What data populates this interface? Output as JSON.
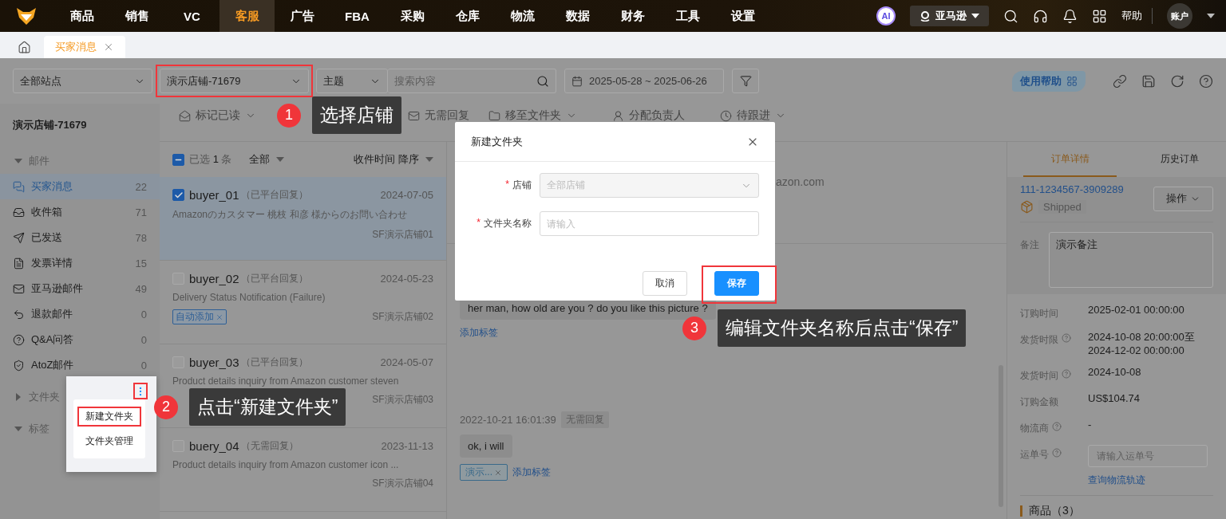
{
  "top_nav": {
    "items": [
      {
        "label": "商品",
        "selected": false
      },
      {
        "label": "销售",
        "selected": false
      },
      {
        "label": "VC",
        "selected": false
      },
      {
        "label": "客服",
        "selected": true
      },
      {
        "label": "广告",
        "selected": false
      },
      {
        "label": "FBA",
        "selected": false
      },
      {
        "label": "采购",
        "selected": false
      },
      {
        "label": "仓库",
        "selected": false
      },
      {
        "label": "物流",
        "selected": false
      },
      {
        "label": "数据",
        "selected": false
      },
      {
        "label": "财务",
        "selected": false
      },
      {
        "label": "工具",
        "selected": false
      },
      {
        "label": "设置",
        "selected": false
      }
    ],
    "ai_badge": "AI",
    "platform": "亚马逊",
    "help": "帮助",
    "account": "账户"
  },
  "page_tabs": [
    {
      "label": "买家消息",
      "selected": true
    }
  ],
  "filters": {
    "site": "全部站点",
    "store": "演示店铺-71679",
    "store_highlighted": true,
    "search_field": "主题",
    "search_placeholder": "搜索内容",
    "date_range": "2025-05-28 ~ 2025-06-26",
    "help_button": "使用帮助"
  },
  "sidebar": {
    "title": "演示店铺-71679",
    "sections": [
      {
        "label": "邮件",
        "expanded": true,
        "items": [
          {
            "label": "买家消息",
            "count": "22",
            "selected": true
          },
          {
            "label": "收件箱",
            "count": "71",
            "selected": false
          },
          {
            "label": "已发送",
            "count": "78",
            "selected": false
          },
          {
            "label": "发票详情",
            "count": "15",
            "selected": false
          },
          {
            "label": "亚马逊邮件",
            "count": "49",
            "selected": false
          },
          {
            "label": "退款邮件",
            "count": "0",
            "selected": false
          },
          {
            "label": "Q&A问答",
            "count": "0",
            "selected": false
          },
          {
            "label": "AtoZ邮件",
            "count": "0",
            "selected": false
          }
        ]
      },
      {
        "label": "文件夹",
        "expanded": false
      },
      {
        "label": "标签",
        "expanded": true
      }
    ]
  },
  "toolbar": [
    {
      "label": "标记已读",
      "dropdown": true
    },
    {
      "label": "无需回复",
      "dropdown": false
    },
    {
      "label": "移至文件夹",
      "dropdown": true
    },
    {
      "label": "分配负责人",
      "dropdown": false
    },
    {
      "label": "待跟进",
      "dropdown": true
    }
  ],
  "message_list": {
    "indeterminate": true,
    "selected_label": "已选",
    "selected_count": "1",
    "selected_unit": "条",
    "filter": "全部",
    "sort": "收件时间 降序",
    "items": [
      {
        "buyer": "buyer_01",
        "status": "（已平台回复）",
        "date": "2024-07-05",
        "subject": "Amazonのカスタマー 桃枝 和彦 様からのお問い合わせ",
        "store": "SF演示店铺01",
        "checked": true,
        "selected": true
      },
      {
        "buyer": "buyer_02",
        "status": "（已平台回复）",
        "date": "2024-05-23",
        "subject": "Delivery Status Notification (Failure)",
        "store": "SF演示店铺02",
        "checked": false,
        "selected": false,
        "tags": [
          {
            "label": "自动添加"
          }
        ]
      },
      {
        "buyer": "buyer_03",
        "status": "（已平台回复）",
        "date": "2024-05-07",
        "subject": "Product details inquiry from Amazon customer steven",
        "store": "SF演示店铺03",
        "checked": false,
        "selected": false
      },
      {
        "buyer": "buery_04",
        "status": "（无需回复）",
        "date": "2023-11-13",
        "subject": "Product details inquiry from Amazon customer icon ...",
        "store": "SF演示店铺04",
        "checked": false,
        "selected": false
      }
    ]
  },
  "conversation": {
    "header_fragment": "azon.com",
    "messages": [
      {
        "text": "her man, how old are you ? do you like this picture ?",
        "add_tag": "添加标签"
      },
      {
        "time": "2022-10-21 16:01:39",
        "status": "无需回复",
        "text": "ok, i will",
        "tags": [
          {
            "label": "演示..."
          }
        ],
        "add_tag": "添加标签"
      }
    ]
  },
  "order_panel": {
    "tabs": [
      {
        "label": "订单详情",
        "selected": true
      },
      {
        "label": "历史订单",
        "selected": false
      }
    ],
    "order_id": "111-1234567-3909289",
    "status": "Shipped",
    "action_button": "操作",
    "note_label": "备注",
    "note": "演示备注",
    "fields": [
      {
        "label": "订购时间",
        "help": false,
        "lines": [
          "2025-02-01 00:00:00"
        ]
      },
      {
        "label": "发货时限",
        "help": true,
        "lines": [
          "2024-10-08 20:00:00至",
          "2024-12-02 00:00:00"
        ]
      },
      {
        "label": "发货时间",
        "help": true,
        "lines": [
          "2024-10-08"
        ]
      },
      {
        "label": "订购金额",
        "help": false,
        "lines": [
          "US$104.74"
        ]
      },
      {
        "label": "物流商",
        "help": true,
        "lines": [
          "-"
        ]
      }
    ],
    "tracking": {
      "label": "运单号",
      "help": true,
      "placeholder": "请输入运单号"
    },
    "tracking_link": "查询物流轨迹",
    "products_heading": "商品（3）"
  },
  "dialog": {
    "title": "新建文件夹",
    "required_mark": "*",
    "fields": [
      {
        "label": "店铺",
        "required": true,
        "kind": "select",
        "value": "全部店铺",
        "disabled": true
      },
      {
        "label": "文件夹名称",
        "required": true,
        "kind": "input",
        "placeholder": "请输入"
      }
    ],
    "buttons": [
      {
        "label": "取消",
        "kind": "default",
        "highlighted": false
      },
      {
        "label": "保存",
        "kind": "primary",
        "highlighted": true
      }
    ]
  },
  "folder_menu": {
    "button_highlighted": true,
    "items": [
      {
        "label": "新建文件夹",
        "highlighted": true
      },
      {
        "label": "文件夹管理",
        "highlighted": false
      }
    ]
  },
  "callouts": [
    {
      "number": "1",
      "text": "选择店铺"
    },
    {
      "number": "2",
      "text": "点击“新建文件夹”"
    },
    {
      "number": "3",
      "text": "编辑文件夹名称后点击“保存”"
    }
  ]
}
